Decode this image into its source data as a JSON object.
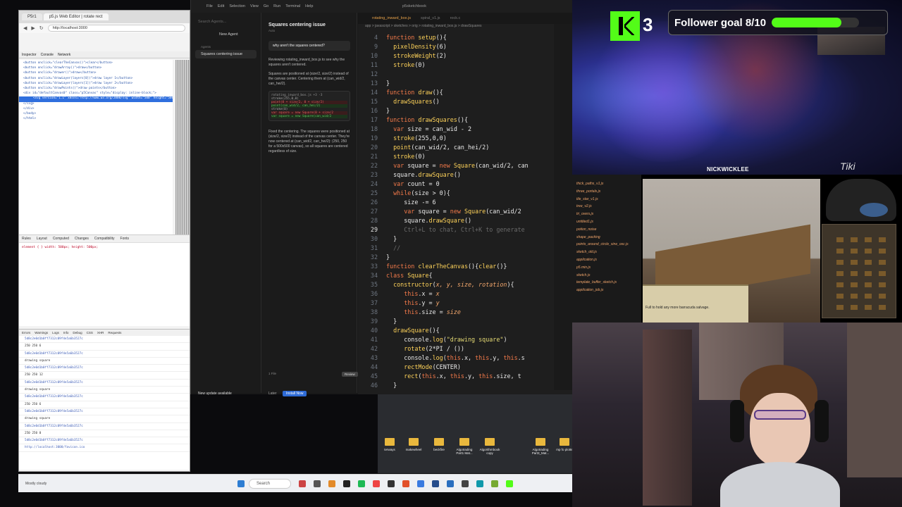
{
  "browser": {
    "tabs": [
      "P5r1",
      "p5.js Web Editor | rotate rect"
    ],
    "url": "http://localhost:3000",
    "devtools_tabs": [
      "Inspector",
      "Console",
      "Network"
    ],
    "inspector_lines": [
      "<button onclick=\"clearTheCanvas()\">clear</button>",
      "<button onclick=\"drawArray()\">draw</button>",
      "<button onclick=\"drawer()\">draw</button>",
      "<button onclick=\"drawLayer(layers[0])\">draw layer 1</button>",
      "<button onclick=\"drawLayer(layers[1])\">draw layer 2</button>",
      "<button onclick=\"drawPoints()\">draw points</button>",
      "<div id=\"defaultCanvas0\" class=\"p5Canvas\" style=\"display: inline-block;\">",
      "<svg version=\"1.1\" xmlns=\"http://www.w3.org/2000/svg\" width=\"500\" height=\"500\" viewBox=\"0 0 500 500\">",
      "</svg>",
      "</div>",
      "</body>",
      "</html>"
    ],
    "rules_tabs": [
      "Rules",
      "Layout",
      "Computed",
      "Changes",
      "Compatibility",
      "Fonts"
    ],
    "rules_code": "element { } width: 500px; height: 500px;",
    "console_tabs": [
      "Errors",
      "Warnings",
      "Logs",
      "Info",
      "Debug",
      "CSS",
      "XHR",
      "Requests"
    ],
    "console_lines": [
      {
        "kind": "hash",
        "text": "5d8c2e0d1b0ff7312c09f4e5a6b3527c"
      },
      {
        "kind": "txt",
        "text": "250 250 6"
      },
      {
        "kind": "hash",
        "text": "5d8c2e0d1b0ff7312c09f4e5a6b3527c"
      },
      {
        "kind": "txt",
        "text": "drawing square"
      },
      {
        "kind": "hash",
        "text": "5d8c2e0d1b0ff7312c09f4e5a6b3527c"
      },
      {
        "kind": "txt",
        "text": "250 250 12"
      },
      {
        "kind": "hash",
        "text": "5d8c2e0d1b0ff7312c09f4e5a6b3527c"
      },
      {
        "kind": "txt",
        "text": "drawing square"
      },
      {
        "kind": "hash",
        "text": "5d8c2e0d1b0ff7312c09f4e5a6b3527c"
      },
      {
        "kind": "txt",
        "text": "250 250 6"
      },
      {
        "kind": "hash",
        "text": "5d8c2e0d1b0ff7312c09f4e5a6b3527c"
      },
      {
        "kind": "txt",
        "text": "drawing square"
      },
      {
        "kind": "hash",
        "text": "5d8c2e0d1b0ff7312c09f4e5a6b3527c"
      },
      {
        "kind": "txt",
        "text": "250 250 0"
      },
      {
        "kind": "hash",
        "text": "5d8c2e0d1b0ff7312c09f4e5a6b3527c"
      },
      {
        "kind": "hash",
        "text": "http://localhost:3000/favicon.ico"
      }
    ]
  },
  "taskbar": {
    "weather": "Mostly cloudy",
    "search": "Search"
  },
  "ide": {
    "menu": [
      "File",
      "Edit",
      "Selection",
      "View",
      "Go",
      "Run",
      "Terminal",
      "Help"
    ],
    "title": "p5sketchbook",
    "agent": {
      "search_placeholder": "Search Agents...",
      "new_agent": "New Agent",
      "agents_label": "Agents",
      "agent_item": "Squares centering issue",
      "chat_title": "Squares centering issue",
      "chat_meta": "Auto",
      "user_message": "why aren't the squares centered?",
      "p1": "Reviewing rotating_inward_box.js to see why the squares aren't centered.",
      "p2": "Squares are positioned at (size/2, size/2) instead of the canvas center. Centering them at (can_wid/2, can_hei/2).",
      "diff_file": "rotating_inward_box.js +3 -3",
      "diff_lines": [
        {
          "kind": "plain",
          "text": "stroke(255,0,0)"
        },
        {
          "kind": "del",
          "text": "point(0 + size/2, 0 + size/2)"
        },
        {
          "kind": "add",
          "text": "point(can_wid/2, can_hei/2)"
        },
        {
          "kind": "plain",
          "text": "stroke(0)"
        },
        {
          "kind": "del",
          "text": "var square = new Square(0 + size/2"
        },
        {
          "kind": "add",
          "text": "var square = new Square(can_wid/2"
        }
      ],
      "p3": "Fixed the centering. The squares were positioned at (size/2, size/2) instead of the canvas center. They're now centered at (can_wid/2, can_hei/2): (250, 250 for a 500x500 canvas), so all squares are centered regardless of size.",
      "files_label": "1 File",
      "review": "Review",
      "update": "New update available",
      "later": "Later",
      "install": "Install Now"
    },
    "editor": {
      "tabs": [
        "rotating_inward_box.js",
        "spiral_v1.js",
        "rock.c"
      ],
      "breadcrumb": "app > javascript > sketches > orig > rotating_inward_box.js > drawSquares",
      "ghost": "Ctrl+L to chat, Ctrl+K to generate"
    }
  },
  "desktop_files": [
    "terways",
    "makewheel",
    "beckfire",
    "Algotrading Part1 Mat...",
    "Algorithmbook copy",
    "Algotrading Part3_Mat...",
    "mp fo plotte"
  ],
  "overlay": {
    "kick_count": "3",
    "follower_goal": "Follower goal 8/10",
    "goal_progress": 0.8,
    "username": "NICKWICKLEE",
    "watermark": "Tiki"
  },
  "game": {
    "files": [
      "thick_paths_v1.js",
      "three_portals.js",
      "tile_star_v1.js",
      "tree_v2.js",
      "tri_overs.js",
      "untitled1.js",
      "potion_noise",
      "shape_packing",
      "points_around_circle_sine_osc.js",
      "sketch_old.js",
      "application.js",
      "p5.min.js",
      "sketch.js",
      "template_buffer_sketch.js",
      "application_job.js"
    ],
    "chat_text": "Full to hold any more barracuda salvage."
  },
  "colors": {
    "kick_green": "#53fc18",
    "accent_blue": "#2e6bd6"
  }
}
